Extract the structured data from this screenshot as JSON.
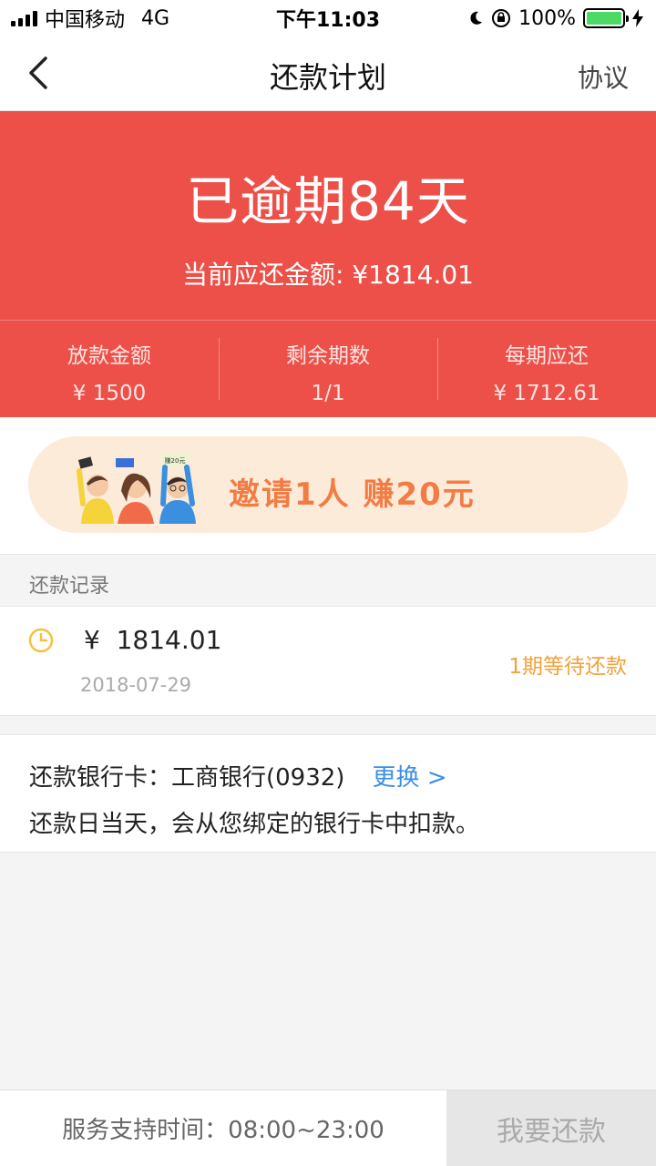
{
  "status_bar": {
    "carrier": "中国移动",
    "network": "4G",
    "time": "下午11:03",
    "battery": "100%"
  },
  "nav": {
    "title": "还款计划",
    "right_label": "协议"
  },
  "hero": {
    "title": "已逾期84天",
    "current_due": "当前应还金额: ¥1814.01",
    "stats": [
      {
        "label": "放款金额",
        "value": "¥ 1500"
      },
      {
        "label": "剩余期数",
        "value": "1/1"
      },
      {
        "label": "每期应还",
        "value": "¥ 1712.61"
      }
    ]
  },
  "banner": {
    "text": "邀请1人 赚20元",
    "tags": [
      "",
      "",
      "赚20元"
    ]
  },
  "records": {
    "header": "还款记录",
    "items": [
      {
        "amount": "¥  1814.01",
        "date": "2018-07-29",
        "status": "1期等待还款"
      }
    ]
  },
  "bank": {
    "label": "还款银行卡：工商银行(0932)",
    "change": "更换 >",
    "note": "还款日当天，会从您绑定的银行卡中扣款。"
  },
  "footer": {
    "support": "服务支持时间：08:00~23:00",
    "repay_button": "我要还款"
  },
  "colors": {
    "brand_red": "#ec5048",
    "accent_orange": "#f2a23a",
    "link_blue": "#3a8ee6",
    "banner_bg": "#fdebd9"
  }
}
